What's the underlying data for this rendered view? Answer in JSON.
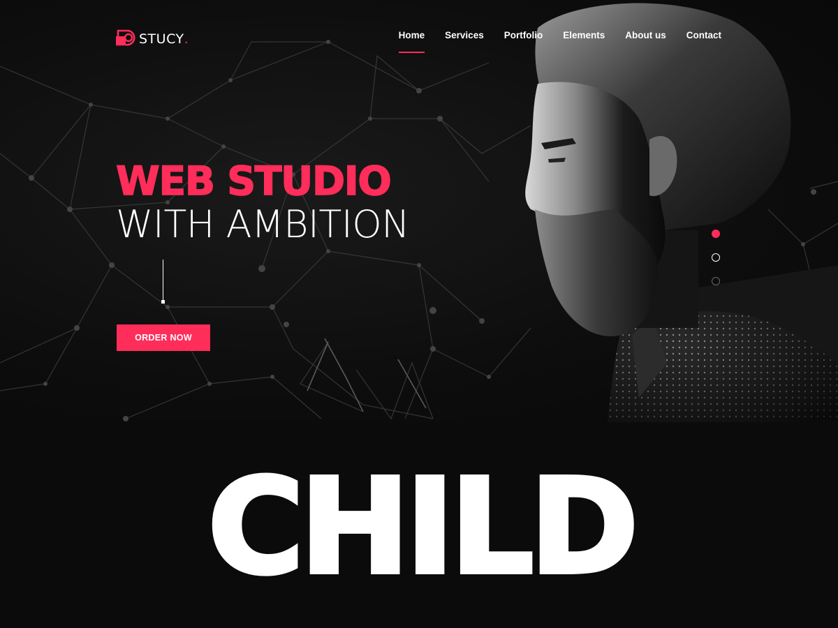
{
  "brand": {
    "name": "STUCY",
    "dot": ".",
    "accent_color": "#ff2d5a",
    "logo_icon": "camera-lens-icon"
  },
  "nav": {
    "items": [
      {
        "label": "Home",
        "active": true
      },
      {
        "label": "Services",
        "active": false
      },
      {
        "label": "Portfolio",
        "active": false
      },
      {
        "label": "Elements",
        "active": false
      },
      {
        "label": "About us",
        "active": false
      },
      {
        "label": "Contact",
        "active": false
      }
    ]
  },
  "hero": {
    "headline_line1": "WEB STUDIO",
    "headline_line2": "WITH AMBITION",
    "cta_label": "ORDER NOW",
    "image": "bearded-man-profile-portrait",
    "background": "network-lines-pattern"
  },
  "slider": {
    "total": 3,
    "active_index": 0
  },
  "banner": {
    "text": "CHILD"
  }
}
